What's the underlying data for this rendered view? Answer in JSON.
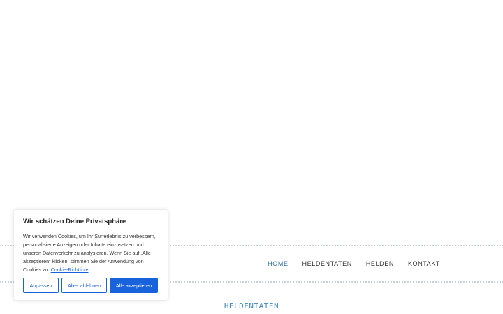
{
  "nav": {
    "items": [
      {
        "label": "HOME",
        "active": true
      },
      {
        "label": "HELDENTATEN",
        "active": false
      },
      {
        "label": "HELDEN",
        "active": false
      },
      {
        "label": "KONTAKT",
        "active": false
      }
    ]
  },
  "section": {
    "title": "HELDENTATEN"
  },
  "cookie_banner": {
    "title": "Wir schätzen Deine Privatsphäre",
    "text": "Wir verwenden Cookies, um Ihr Surferlebnis zu verbessern, personalisierte Anzeigen oder Inhalte einzusetzen und unseren Datenverkehr zu analysieren. Wenn Sie auf „Alle akzeptieren“ klicken, stimmen Sie der Anwendung von Cookies zu.",
    "policy_link": "Cookie-Richtlinie",
    "buttons": {
      "customize": "Anpassen",
      "reject": "Alles ablehnen",
      "accept": "Alle akzeptieren"
    }
  },
  "colors": {
    "accent": "#1863dc",
    "nav_active": "#2f6e9e",
    "section_title": "#3f87bf"
  }
}
